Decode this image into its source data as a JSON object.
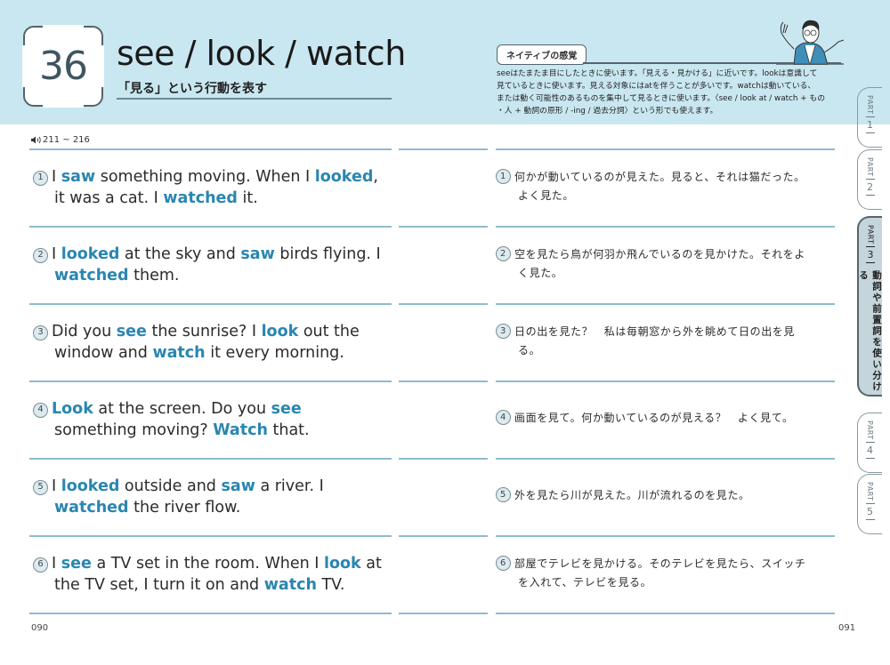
{
  "header": {
    "lesson_number": "36",
    "title": "see / look / watch",
    "subtitle": "「見る」という行動を表す",
    "colors": {
      "header_bg": "#c9e7f1",
      "accent": "#2a86b1"
    }
  },
  "native_sense": {
    "tag": "ネイティブの感覚",
    "lines": [
      "seeはたまたま目にしたときに使います。「見える・見かける」に近いです。lookは意識して",
      "見ているときに使います。見える対象にはatを伴うことが多いです。watchは動いている、",
      "または動く可能性のあるものを集中して見るときに使います。〈see / look at / watch + もの",
      "・人 + 動詞の原形 / -ing / 過去分詞〉という形でも使えます。"
    ],
    "illustration": "teacher-mascot-icon"
  },
  "audio": {
    "icon": "speaker-icon",
    "range": "211 ~ 216"
  },
  "sentences": [
    {
      "num": "1",
      "en": [
        [
          [
            "",
            "I "
          ],
          [
            "b",
            "saw"
          ],
          [
            "",
            " something moving. When I "
          ],
          [
            "b",
            "looked"
          ],
          [
            "",
            ","
          ]
        ],
        [
          [
            "",
            "it was a cat. I "
          ],
          [
            "b",
            "watched"
          ],
          [
            "",
            " it."
          ]
        ]
      ],
      "ja": [
        "何かが動いているのが見えた。見ると、それは猫だった。",
        "よく見た。"
      ]
    },
    {
      "num": "2",
      "en": [
        [
          [
            "",
            "I "
          ],
          [
            "b",
            "looked"
          ],
          [
            "",
            " at the sky and "
          ],
          [
            "b",
            "saw"
          ],
          [
            "",
            " birds flying. I"
          ]
        ],
        [
          [
            "b",
            "watched"
          ],
          [
            "",
            " them."
          ]
        ]
      ],
      "ja": [
        "空を見たら鳥が何羽か飛んでいるのを見かけた。それをよ",
        "く見た。"
      ]
    },
    {
      "num": "3",
      "en": [
        [
          [
            "",
            "Did you "
          ],
          [
            "b",
            "see"
          ],
          [
            "",
            " the sunrise? I "
          ],
          [
            "b",
            "look"
          ],
          [
            "",
            " out the"
          ]
        ],
        [
          [
            "",
            "window and "
          ],
          [
            "b",
            "watch"
          ],
          [
            "",
            " it every morning."
          ]
        ]
      ],
      "ja": [
        "日の出を見た？　私は毎朝窓から外を眺めて日の出を見",
        "る。"
      ]
    },
    {
      "num": "4",
      "en": [
        [
          [
            "b",
            "Look"
          ],
          [
            "",
            " at the screen. Do you "
          ],
          [
            "b",
            "see"
          ]
        ],
        [
          [
            "",
            "something moving? "
          ],
          [
            "b",
            "Watch"
          ],
          [
            "",
            " that."
          ]
        ]
      ],
      "ja": [
        "画面を見て。何か動いているのが見える？　よく見て。"
      ]
    },
    {
      "num": "5",
      "en": [
        [
          [
            "",
            "I "
          ],
          [
            "b",
            "looked"
          ],
          [
            "",
            " outside and "
          ],
          [
            "b",
            "saw"
          ],
          [
            "",
            " a river. I"
          ]
        ],
        [
          [
            "b",
            "watched"
          ],
          [
            "",
            " the river flow."
          ]
        ]
      ],
      "ja": [
        "外を見たら川が見えた。川が流れるのを見た。"
      ]
    },
    {
      "num": "6",
      "en": [
        [
          [
            "",
            "I "
          ],
          [
            "b",
            "see"
          ],
          [
            "",
            " a TV set in the room. When I "
          ],
          [
            "b",
            "look"
          ],
          [
            "",
            " at"
          ]
        ],
        [
          [
            "",
            "the TV set, I turn it on and "
          ],
          [
            "b",
            "watch"
          ],
          [
            "",
            " TV."
          ]
        ]
      ],
      "ja": [
        "部屋でテレビを見かける。そのテレビを見たら、スイッチ",
        "を入れて、テレビを見る。"
      ]
    }
  ],
  "page_numbers": {
    "left": "090",
    "right": "091"
  },
  "tabs": [
    {
      "part": "PART",
      "num": "1",
      "active": false
    },
    {
      "part": "PART",
      "num": "2",
      "active": false
    },
    {
      "part": "PART",
      "num": "3",
      "active": true,
      "label": "動詞や前置詞を使い分ける"
    },
    {
      "part": "PART",
      "num": "4",
      "active": false
    },
    {
      "part": "PART",
      "num": "5",
      "active": false
    }
  ]
}
